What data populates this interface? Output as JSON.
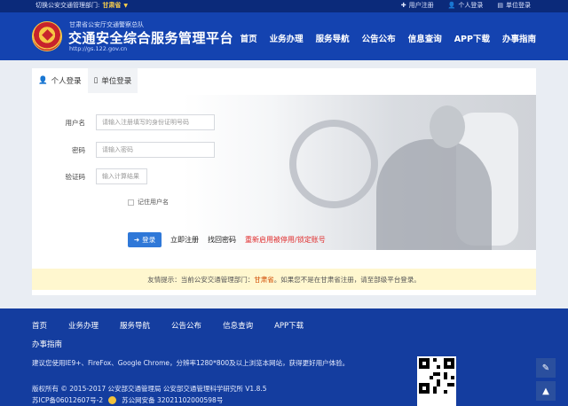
{
  "topbar": {
    "switch_label": "切换公安交通管理部门:",
    "province": "甘肃省",
    "links": [
      {
        "icon": "plus-icon",
        "label": "用户注册"
      },
      {
        "icon": "person-icon",
        "label": "个人登录"
      },
      {
        "icon": "building-icon",
        "label": "单位登录"
      }
    ]
  },
  "header": {
    "subtitle": "甘肃省公安厅交通警察总队",
    "title": "交通安全综合服务管理平台",
    "url": "http://gs.122.gov.cn",
    "nav": [
      "首页",
      "业务办理",
      "服务导航",
      "公告公布",
      "信息查询",
      "APP下载",
      "办事指南"
    ]
  },
  "login": {
    "tabs": [
      {
        "icon": "person-icon",
        "label": "个人登录"
      },
      {
        "icon": "doc-icon",
        "label": "单位登录"
      }
    ],
    "username": {
      "label": "用户名",
      "placeholder": "请输入注册填写的身份证明号码"
    },
    "password": {
      "label": "密码",
      "placeholder": "请输入密码"
    },
    "captcha": {
      "label": "验证码",
      "placeholder": "输入计算结果"
    },
    "remember": "记住用户名",
    "login_button": "登录",
    "register_link": "立即注册",
    "find_password_link": "找回密码",
    "reenable_link": "重新启用被停用/锁定账号",
    "notice_prefix": "友情提示：当前公安交通管理部门：",
    "notice_province": "甘肃省",
    "notice_suffix": "。如果您不是在甘肃省注册，请至部级平台登录。"
  },
  "footer": {
    "nav": [
      "首页",
      "业务办理",
      "服务导航",
      "公告公布",
      "信息查询",
      "APP下载"
    ],
    "nav2": "办事指南",
    "browser_note": "建议您使用IE9+、FireFox、Google Chrome，分辨率1280*800及以上浏览本网站，获得更好用户体验。",
    "copyright": "版权所有 © 2015-2017 公安部交通管理局 公安部交通管理科学研究所 V1.8.5",
    "icp": "苏ICP备06012607号-2",
    "police_record": "苏公网安备 32021102000598号"
  },
  "colors": {
    "topbar": "#0b2a7a",
    "header": "#1443b0",
    "footer": "#143d9f",
    "login_button": "#2f78d8",
    "notice_bg": "#fff7cf",
    "red_link": "#e02a2a"
  }
}
